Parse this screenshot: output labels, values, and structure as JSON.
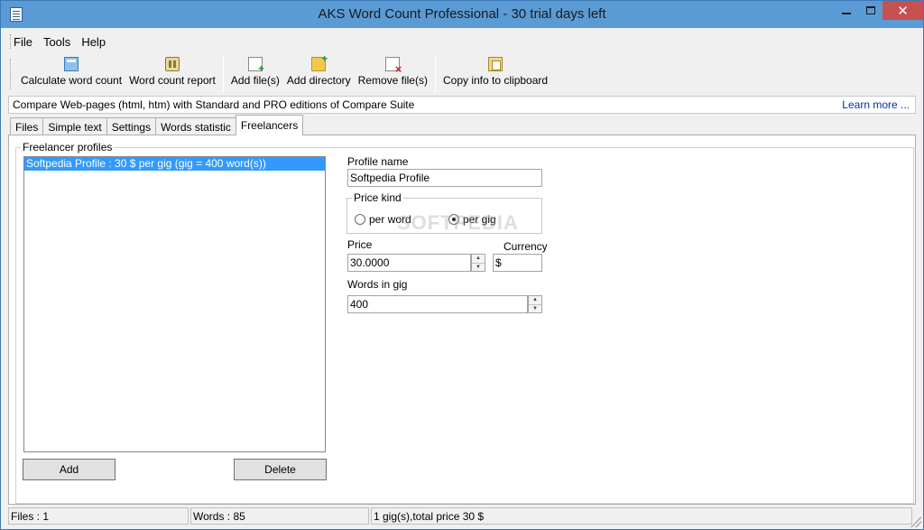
{
  "window": {
    "title": "AKS Word Count Professional - 30 trial days left",
    "close_glyph": "✕"
  },
  "menu": [
    {
      "label": "File"
    },
    {
      "label": "Tools"
    },
    {
      "label": "Help"
    }
  ],
  "toolbar": {
    "calculate": "Calculate word count",
    "report": "Word count report",
    "add_files": "Add file(s)",
    "add_directory": "Add directory",
    "remove_files": "Remove file(s)",
    "copy_info": "Copy info to clipboard"
  },
  "ad_bar": {
    "text": "Compare Web-pages (html, htm) with Standard and PRO editions of Compare Suite",
    "link": "Learn more ..."
  },
  "tabs": [
    {
      "label": "Files",
      "active": false
    },
    {
      "label": "Simple text",
      "active": false
    },
    {
      "label": "Settings",
      "active": false
    },
    {
      "label": "Words statistic",
      "active": false
    },
    {
      "label": "Freelancers",
      "active": true
    }
  ],
  "freelancers": {
    "group_label": "Freelancer profiles",
    "profiles": [
      {
        "label": "Softpedia Profile : 30 $ per gig (gig = 400 word(s))",
        "selected": true
      }
    ],
    "add_button": "Add",
    "delete_button": "Delete",
    "profile_name_label": "Profile name",
    "profile_name_value": "Softpedia Profile",
    "price_kind_label": "Price kind",
    "price_kind_options": [
      {
        "label": "per word",
        "selected": false
      },
      {
        "label": "per gig",
        "selected": true
      }
    ],
    "price_label": "Price",
    "price_value": "30.0000",
    "currency_label": "Currency",
    "currency_value": "$",
    "words_in_gig_label": "Words in gig",
    "words_in_gig_value": "400",
    "watermark": "SOFTPEDIA"
  },
  "status": {
    "files": "Files : 1",
    "words": "Words : 85",
    "price": "1 gig(s),total price 30 $"
  }
}
